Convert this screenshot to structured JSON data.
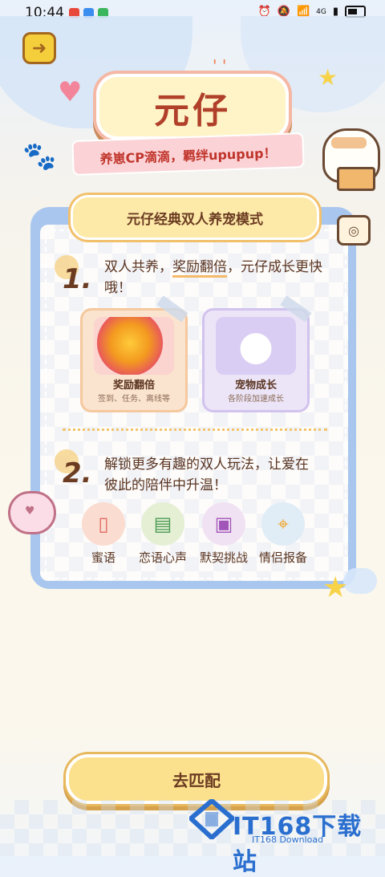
{
  "status_bar": {
    "time": "10:44",
    "network": "4G",
    "colors": {
      "app1": "#e8483a",
      "app2": "#3b8df0",
      "app3": "#3ab65c"
    }
  },
  "header": {
    "back_icon": "back-arrow-icon",
    "title": "元仔",
    "subtitle": "养崽CP滴滴，羁绊upupup！"
  },
  "card": {
    "title": "元仔经典双人养宠模式",
    "step1": {
      "number": "1.",
      "text_pre": "双人共养，",
      "text_highlight": "奖励翻倍",
      "text_post": "，元仔成长更快哦！"
    },
    "features": [
      {
        "title": "奖励翻倍",
        "subtitle": "签到、任务、离线等"
      },
      {
        "title": "宠物成长",
        "subtitle": "各阶段加速成长"
      }
    ],
    "step2": {
      "number": "2.",
      "text": "解锁更多有趣的双人玩法，让爱在彼此的陪伴中升温！"
    },
    "modes": [
      {
        "label": "蜜语",
        "icon": "phone-icon"
      },
      {
        "label": "恋语心声",
        "icon": "book-icon"
      },
      {
        "label": "默契挑战",
        "icon": "game-console-icon"
      },
      {
        "label": "情侣报备",
        "icon": "map-pin-icon"
      }
    ]
  },
  "match_button": {
    "label": "去匹配"
  },
  "watermark": {
    "text": "IT168下载站",
    "sub": "IT168 Download"
  }
}
